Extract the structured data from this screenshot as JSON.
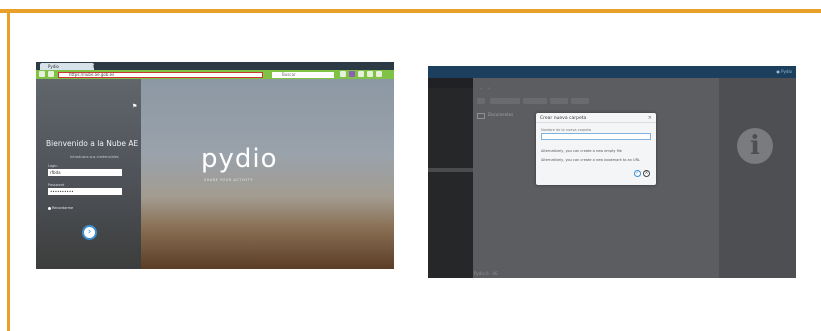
{
  "left_screenshot": {
    "browser": {
      "tab_title": "Pydio",
      "url": "https://nube.ae.gob.es",
      "search_placeholder": "Buscar"
    },
    "login": {
      "welcome": "Bienvenido a la Nube AE",
      "subtitle": "Introduzca sus credenciales",
      "user_label": "Login",
      "user_value": "rfbda",
      "password_label": "Password",
      "password_value": "••••••••••",
      "remember_label": "Recordarme",
      "submit_symbol": "›"
    },
    "brand": {
      "logo": "pydio",
      "tagline": "SHARE YOUR ACTIVITY"
    }
  },
  "right_screenshot": {
    "topbar_right": "● Pydio",
    "folder_label": "Documentos",
    "info_symbol": "i",
    "bottom_text": "Pydio 6 · AE",
    "dialog": {
      "title": "Crear nueva carpeta",
      "close_symbol": "×",
      "input_label": "Nombre de la nueva carpeta",
      "hint_file": "Alternatively, you can create a new empty file",
      "hint_bookmark": "Alternatively, you can create a new bookmark to an URL",
      "ok_symbol": "✓",
      "cancel_symbol": "×"
    }
  },
  "colors": {
    "border": "#e8a02a",
    "browser_toolbar": "#7fc246",
    "accent_blue": "#3b8fd1",
    "topbar_blue": "#1b3f5c"
  }
}
